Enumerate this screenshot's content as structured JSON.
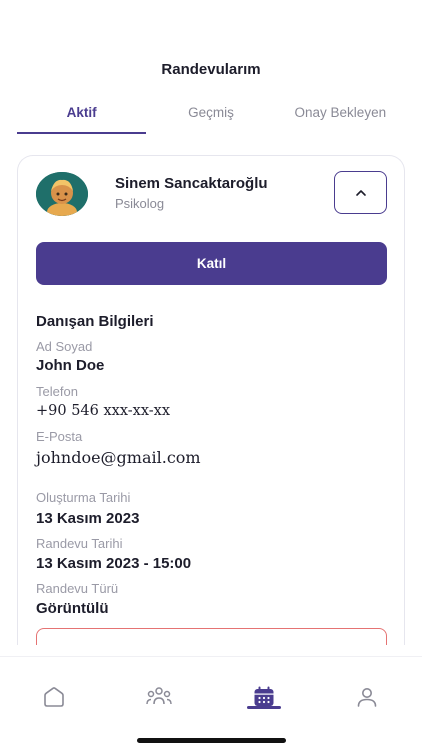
{
  "header": {
    "title": "Randevularım"
  },
  "tabs": [
    {
      "label": "Aktif",
      "active": true
    },
    {
      "label": "Geçmiş",
      "active": false
    },
    {
      "label": "Onay Bekleyen",
      "active": false
    }
  ],
  "appointment": {
    "doctor_name": "Sinem Sancaktaroğlu",
    "doctor_role": "Psikolog",
    "join_label": "Katıl",
    "client_section_title": "Danışan Bilgileri",
    "fields": {
      "name_label": "Ad Soyad",
      "name_value": "John Doe",
      "phone_label": "Telefon",
      "phone_value": "+90 546 xxx-xx-xx",
      "email_label": "E-Posta",
      "email_value": "johndoe@gmail.com",
      "created_label": "Oluşturma Tarihi",
      "created_value": "13 Kasım 2023",
      "date_label": "Randevu Tarihi",
      "date_value": "13 Kasım 2023 - 15:00",
      "type_label": "Randevu Türü",
      "type_value": "Görüntülü"
    }
  },
  "bottom_nav": [
    {
      "icon": "home-icon",
      "active": false
    },
    {
      "icon": "people-group-icon",
      "active": false
    },
    {
      "icon": "calendar-icon",
      "active": true
    },
    {
      "icon": "profile-icon",
      "active": false
    }
  ],
  "colors": {
    "accent": "#4a3c8f",
    "muted": "#8a8a96",
    "danger": "#e57373"
  }
}
